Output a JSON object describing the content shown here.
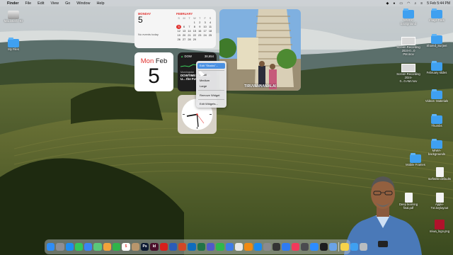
{
  "menubar": {
    "apple": "",
    "items": [
      "Finder",
      "File",
      "Edit",
      "View",
      "Go",
      "Window",
      "Help"
    ],
    "clock": "5 Feb 5:44 PM"
  },
  "desktop_left": [
    {
      "label": "Macintosh HD"
    },
    {
      "label": "My Files"
    }
  ],
  "desktop_right": [
    {
      "label": "Image Files",
      "type": "folder"
    },
    {
      "label": "WWDC background",
      "type": "folder"
    },
    {
      "label": "Shared_Surjeet",
      "type": "folder"
    },
    {
      "label": "Screen Recording 2024-0...0 PM.mov",
      "type": "shot"
    },
    {
      "label": "February slides",
      "type": "folder"
    },
    {
      "label": "Screen Recording 2024-0...0.AM.mov",
      "type": "shot"
    },
    {
      "label": "Videos- Materials",
      "type": "folder"
    },
    {
      "label": "Thumbs",
      "type": "folder"
    },
    {
      "label": "Mobile Frames",
      "type": "folder"
    },
    {
      "label": "MIWA-backgrounds",
      "type": "folder"
    },
    {
      "label": "surfwrite-defaults",
      "type": "doc"
    },
    {
      "label": "Deep learning final.pdf",
      "type": "doc"
    },
    {
      "label": "Apple-Txt.keylayout",
      "type": "doc"
    },
    {
      "label": "miwa_logo.png",
      "type": "red"
    }
  ],
  "calendar": {
    "weekday": "MONDAY",
    "day": "5",
    "no_events": "No events today",
    "month": "FEBRUARY",
    "headers": [
      "S",
      "M",
      "T",
      "W",
      "T",
      "F",
      "S"
    ],
    "weeks": [
      [
        "",
        "",
        "",
        "1",
        "2",
        "3",
        "4"
      ],
      [
        "5",
        "6",
        "7",
        "8",
        "9",
        "10",
        "11"
      ],
      [
        "12",
        "13",
        "14",
        "15",
        "16",
        "17",
        "18"
      ],
      [
        "19",
        "20",
        "21",
        "22",
        "23",
        "24",
        "25"
      ],
      [
        "26",
        "27",
        "28",
        "29",
        "",
        "",
        ""
      ]
    ],
    "today": "5"
  },
  "date_widget": {
    "weekday": "Mon",
    "month": "Feb",
    "day": "5"
  },
  "stocks": {
    "symbol": "DOW",
    "value": "38,654",
    "meta": "Morningstar",
    "headline": "DOWTIMES... Vision U... the Futur..."
  },
  "photo": {
    "caption": "TIRUVANNAMALAI"
  },
  "context_menu": {
    "items": [
      {
        "label": "Edit \"Stocks\"...",
        "highlight": true
      },
      {
        "label": "Small"
      },
      {
        "label": "Medium"
      },
      {
        "label": "Large"
      },
      {
        "label": "Remove Widget"
      },
      {
        "label": "Edit Widgets..."
      }
    ]
  },
  "dock": {
    "apps": [
      {
        "name": "finder-app",
        "color": "#2f8df5",
        "text": ""
      },
      {
        "name": "launchpad-app",
        "color": "#8e8e93",
        "text": ""
      },
      {
        "name": "safari-app",
        "color": "#1f8cf0",
        "text": ""
      },
      {
        "name": "messages-app",
        "color": "#34c759",
        "text": ""
      },
      {
        "name": "mail-app",
        "color": "#3a84f5",
        "text": ""
      },
      {
        "name": "maps-app",
        "color": "#5ac87a",
        "text": ""
      },
      {
        "name": "photos-app",
        "color": "#f2a33a",
        "text": ""
      },
      {
        "name": "facetime-app",
        "color": "#30b34a",
        "text": ""
      },
      {
        "name": "calendar-app",
        "color": "#ffffff",
        "text": "5"
      },
      {
        "name": "contacts-app",
        "color": "#b9966c",
        "text": ""
      },
      {
        "name": "photoshop-app",
        "color": "#0d1a33",
        "text": "Ps"
      },
      {
        "name": "indesign-app",
        "color": "#4a0e2a",
        "text": "Id"
      },
      {
        "name": "acrobat-app",
        "color": "#d8201c",
        "text": ""
      },
      {
        "name": "word-app",
        "color": "#2b5cb8",
        "text": ""
      },
      {
        "name": "powerpoint-app",
        "color": "#d24726",
        "text": ""
      },
      {
        "name": "outlook-app",
        "color": "#0f6cbd",
        "text": ""
      },
      {
        "name": "excel-app",
        "color": "#217346",
        "text": ""
      },
      {
        "name": "teams-app",
        "color": "#5059c9",
        "text": ""
      },
      {
        "name": "numbers-app",
        "color": "#2fb84a",
        "text": ""
      },
      {
        "name": "keynote-app",
        "color": "#3d7be6",
        "text": ""
      },
      {
        "name": "chrome-app",
        "color": "#e8e8e8",
        "text": ""
      },
      {
        "name": "vlc-app",
        "color": "#f08a12",
        "text": ""
      },
      {
        "name": "appstore-app",
        "color": "#1b8af0",
        "text": ""
      },
      {
        "name": "settings-app",
        "color": "#8a8a8e",
        "text": ""
      },
      {
        "name": "finalcut-app",
        "color": "#333333",
        "text": ""
      },
      {
        "name": "xcode-app",
        "color": "#2f7bf2",
        "text": ""
      },
      {
        "name": "music-app",
        "color": "#f23a5b",
        "text": ""
      },
      {
        "name": "quicktime-app",
        "color": "#4a4a4f",
        "text": ""
      },
      {
        "name": "zoom-app",
        "color": "#2d8cff",
        "text": ""
      },
      {
        "name": "terminal-app",
        "color": "#1c1c1e",
        "text": ""
      },
      {
        "name": "preview-app",
        "color": "#6aa3e8",
        "text": ""
      },
      {
        "name": "notes-app",
        "color": "#f7d34a",
        "text": ""
      },
      {
        "name": "downloads-stack",
        "color": "#3fa0f0",
        "text": ""
      },
      {
        "name": "trash-app",
        "color": "#b8bcc0",
        "text": ""
      }
    ]
  }
}
